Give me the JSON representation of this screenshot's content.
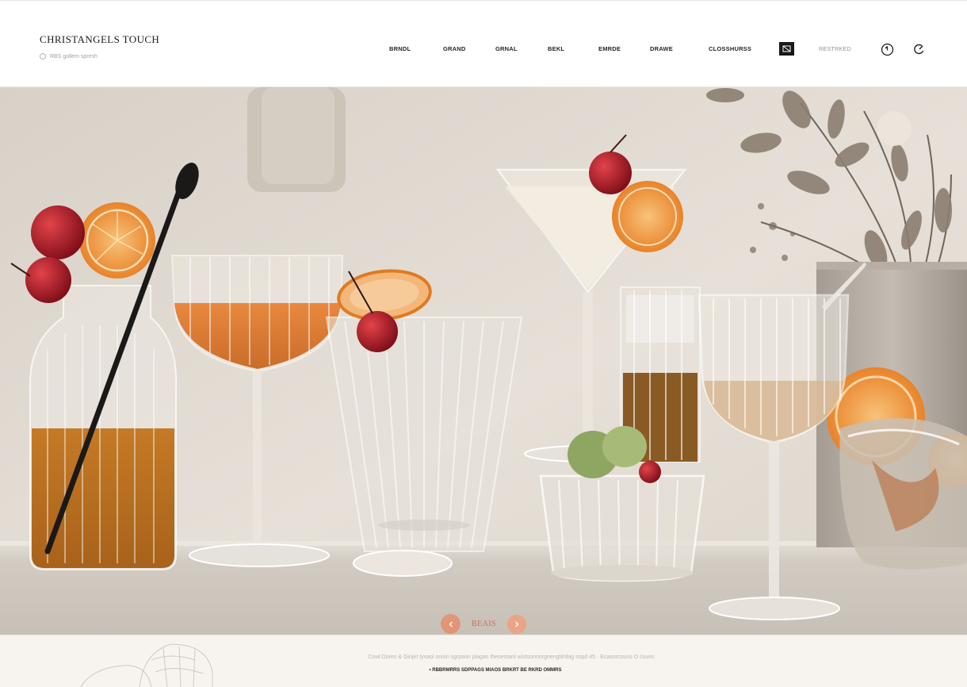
{
  "header": {
    "brand": "CHRISTANGELS TOUCH",
    "tagline": "RBS gollem spresh"
  },
  "nav": {
    "items": [
      {
        "label": "BRNDL"
      },
      {
        "label": "GRAND"
      },
      {
        "label": "GRNAL"
      },
      {
        "label": "BEKL"
      },
      {
        "label": "EMRDE"
      },
      {
        "label": "DRAWE"
      },
      {
        "label": "CLOSSHURSS"
      }
    ],
    "secondary_label": "RESTRKED"
  },
  "icons": {
    "active_nav": "bag-icon",
    "account": "user-circle-icon",
    "search": "search-icon",
    "location": "pin-icon"
  },
  "hero": {
    "carousel_label": "BEAIS",
    "accent_color": "#e5906c"
  },
  "footer": {
    "line": "Cowl Dores & Ginjet tyvaol onoin sgrpaon plagas thesemanl wistsonnorgnengtimbig sopd 45 · Ecasorcouns O couns",
    "subline": "• RBBRMRRS SDPPAGS MIAOS BRKRT BE RKRD OMMRS"
  }
}
